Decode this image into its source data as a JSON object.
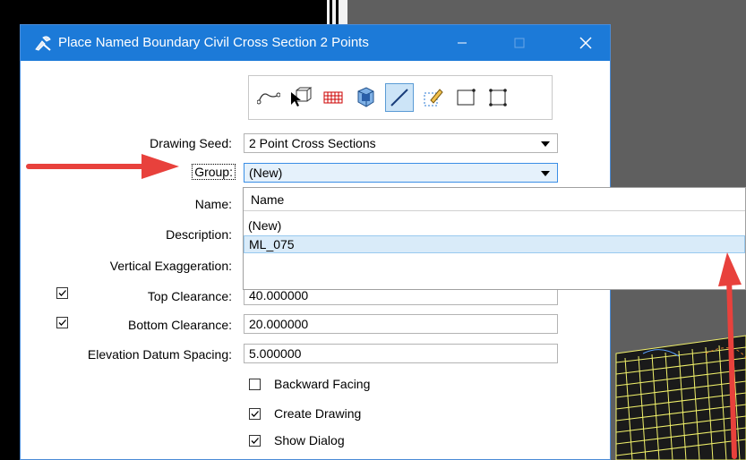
{
  "dialog": {
    "title": "Place Named Boundary Civil Cross Section 2 Points",
    "controls": {
      "minimize": "—",
      "maximize": "☐",
      "close": "✕"
    }
  },
  "toolbar": {
    "tools": [
      "path-tool",
      "arrow-select-tool",
      "grid-tool",
      "3d-box-tool",
      "line-tool",
      "edit-tool",
      "rectangle-tool",
      "rectangle-corners-tool"
    ],
    "active": "line-tool"
  },
  "form": {
    "drawing_seed_label": "Drawing Seed:",
    "drawing_seed_value": "2 Point Cross Sections",
    "group_label": "Group:",
    "group_value": "(New)",
    "name_label": "Name:",
    "description_label": "Description:",
    "vertical_exaggeration_label": "Vertical Exaggeration:",
    "top_clearance_label": "Top Clearance:",
    "top_clearance_value": "40.000000",
    "top_clearance_checked": true,
    "bottom_clearance_label": "Bottom Clearance:",
    "bottom_clearance_value": "20.000000",
    "bottom_clearance_checked": true,
    "elevation_datum_label": "Elevation Datum Spacing:",
    "elevation_datum_value": "5.000000",
    "backward_facing_label": "Backward Facing",
    "backward_facing_checked": false,
    "create_drawing_label": "Create Drawing",
    "create_drawing_checked": true,
    "show_dialog_label": "Show Dialog",
    "show_dialog_checked": true
  },
  "group_dropdown": {
    "header": "Name",
    "items": [
      "(New)",
      "ML_075"
    ],
    "selected": "ML_075"
  },
  "colors": {
    "titlebar": "#1c7ad8",
    "annotation_arrow": "#e8413c",
    "selection": "#d9ebf9"
  }
}
